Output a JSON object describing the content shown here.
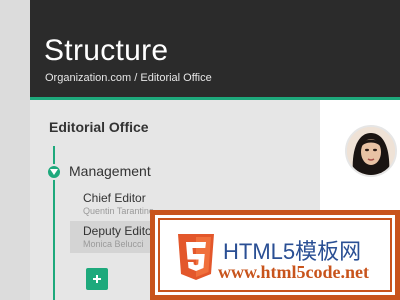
{
  "header": {
    "title": "Structure",
    "breadcrumb": "Organization.com / Editorial Office"
  },
  "panel": {
    "title": "Editorial Office",
    "group": {
      "label": "Management",
      "icon": "chevron-down-icon",
      "members": [
        {
          "title": "Chief Editor",
          "name": "Quentin Tarantino"
        },
        {
          "title": "Deputy Editor",
          "name": "Monica Belucci"
        }
      ]
    },
    "add_button": "+"
  },
  "watermark": {
    "title": "HTML5模板网",
    "url": "www.html5code.net",
    "logo_digit": "5"
  },
  "colors": {
    "accent": "#1ea97c",
    "header_bg": "#2b2b2b",
    "watermark_orange": "#c8541c",
    "watermark_blue": "#2a4f94"
  }
}
